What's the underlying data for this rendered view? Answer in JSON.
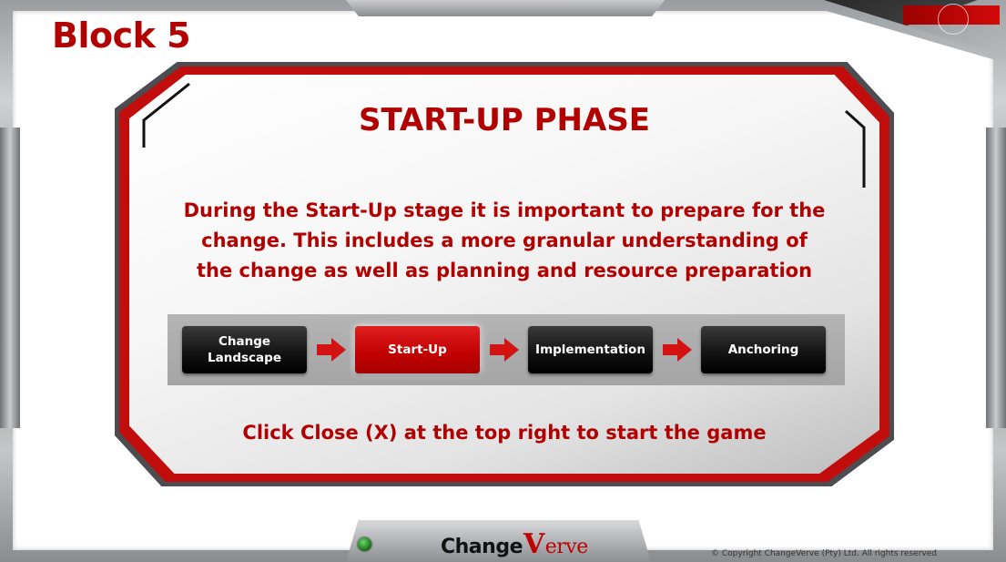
{
  "block": {
    "title": "Block 5"
  },
  "card": {
    "heading": "START-UP PHASE",
    "body": "During the Start-Up stage it is important to prepare for the change. This includes a more granular understanding of the change as well as planning and resource preparation",
    "hint": "Click Close (X) at the top right to start the game"
  },
  "process": {
    "steps": [
      {
        "label": "Change Landscape",
        "active": false
      },
      {
        "label": "Start-Up",
        "active": true
      },
      {
        "label": "Implementation",
        "active": false
      },
      {
        "label": "Anchoring",
        "active": false
      }
    ]
  },
  "footer": {
    "logo_change": "Change",
    "logo_v": "V",
    "logo_verve": "erve",
    "copyright": "© Copyright ChangeVerve (Pty) Ltd. All rights reserved"
  },
  "colors": {
    "accent_red": "#b20000",
    "active_step": "#c00000",
    "inactive_step": "#111111",
    "status_light": "#2e9b2e"
  }
}
